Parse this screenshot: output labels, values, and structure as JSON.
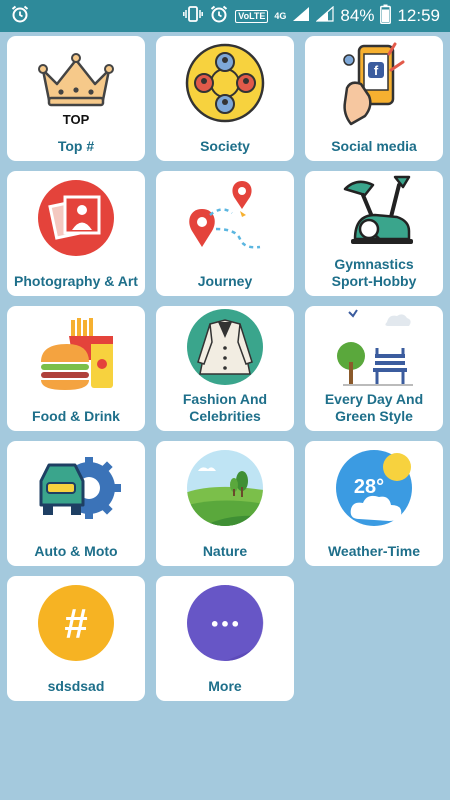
{
  "status_bar": {
    "alarm_icon": "alarm-clock-icon",
    "vibrate_icon": "vibrate-icon",
    "volte_label": "VoLTE",
    "network_label": "4G",
    "battery_percent": "84%",
    "time": "12:59"
  },
  "categories": [
    {
      "id": "top",
      "label": "Top #",
      "icon": "crown-icon",
      "icon_text": "TOP"
    },
    {
      "id": "society",
      "label": "Society",
      "icon": "people-circle-icon"
    },
    {
      "id": "social-media",
      "label": "Social media",
      "icon": "phone-hand-icon"
    },
    {
      "id": "photography-art",
      "label": "Photography & Art",
      "icon": "photos-icon"
    },
    {
      "id": "journey",
      "label": "Journey",
      "icon": "map-pins-icon"
    },
    {
      "id": "gymnastics",
      "label": "Gymnastics\nSport-Hobby",
      "icon": "exercise-bike-icon"
    },
    {
      "id": "food-drink",
      "label": "Food & Drink",
      "icon": "burger-fries-icon"
    },
    {
      "id": "fashion",
      "label": "Fashion And\nCelebrities",
      "icon": "jacket-icon"
    },
    {
      "id": "every-day",
      "label": "Every Day And\nGreen Style",
      "icon": "park-bench-icon"
    },
    {
      "id": "auto-moto",
      "label": "Auto & Moto",
      "icon": "car-gear-icon"
    },
    {
      "id": "nature",
      "label": "Nature",
      "icon": "landscape-icon"
    },
    {
      "id": "weather-time",
      "label": "Weather-Time",
      "icon": "weather-icon",
      "icon_text": "28°"
    },
    {
      "id": "sdsdsad",
      "label": "sdsdsad",
      "icon": "hashtag-icon",
      "icon_text": "#"
    },
    {
      "id": "more",
      "label": "More",
      "icon": "more-dots-icon",
      "icon_text": "•••"
    }
  ]
}
